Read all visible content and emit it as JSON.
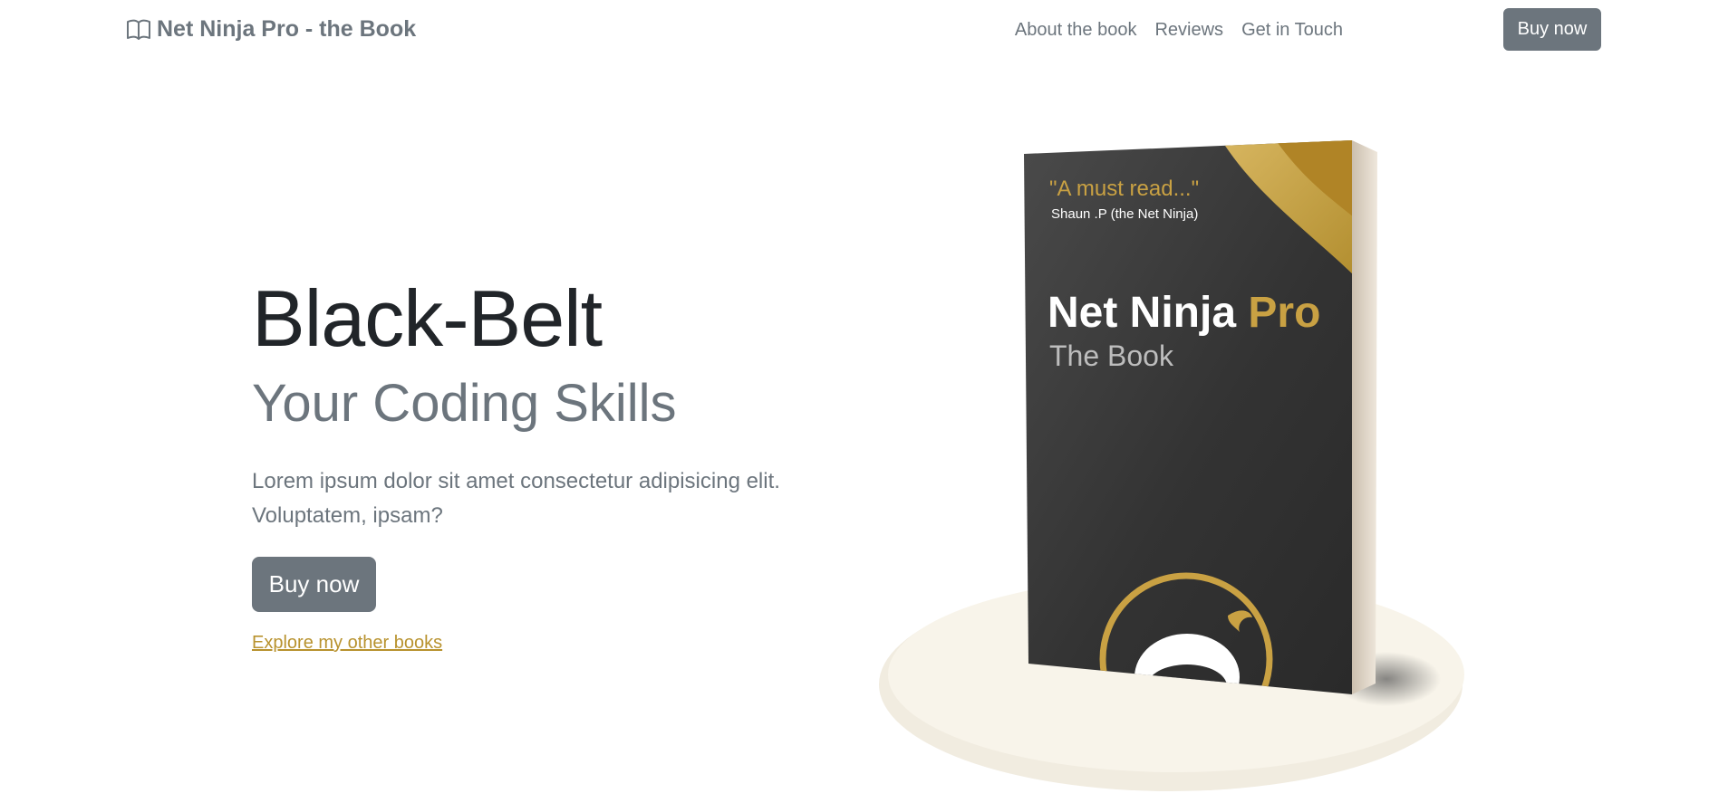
{
  "navbar": {
    "brand_label": "Net Ninja Pro - the Book",
    "brand_icon": "book-icon",
    "links": [
      {
        "label": "About the book"
      },
      {
        "label": "Reviews"
      },
      {
        "label": "Get in Touch"
      }
    ],
    "buy_label": "Buy now"
  },
  "hero": {
    "title": "Black-Belt",
    "subtitle": "Your Coding Skills",
    "lead_line1": "Lorem ipsum dolor sit amet consectetur adipisicing elit.",
    "lead_line2": "Voluptatem, ipsam?",
    "buy_label": "Buy now",
    "explore_link": "Explore my other books"
  },
  "book_cover": {
    "quote": "\"A must read...\"",
    "quote_author": "Shaun .P (the Net Ninja)",
    "title_white": "Net Ninja",
    "title_gold": "Pro",
    "subtitle": "The Book"
  },
  "colors": {
    "secondary": "#6c757d",
    "accent_gold": "#b8922e",
    "cover_dark": "#3a3a3a",
    "base_cream": "#f7f3e8"
  }
}
